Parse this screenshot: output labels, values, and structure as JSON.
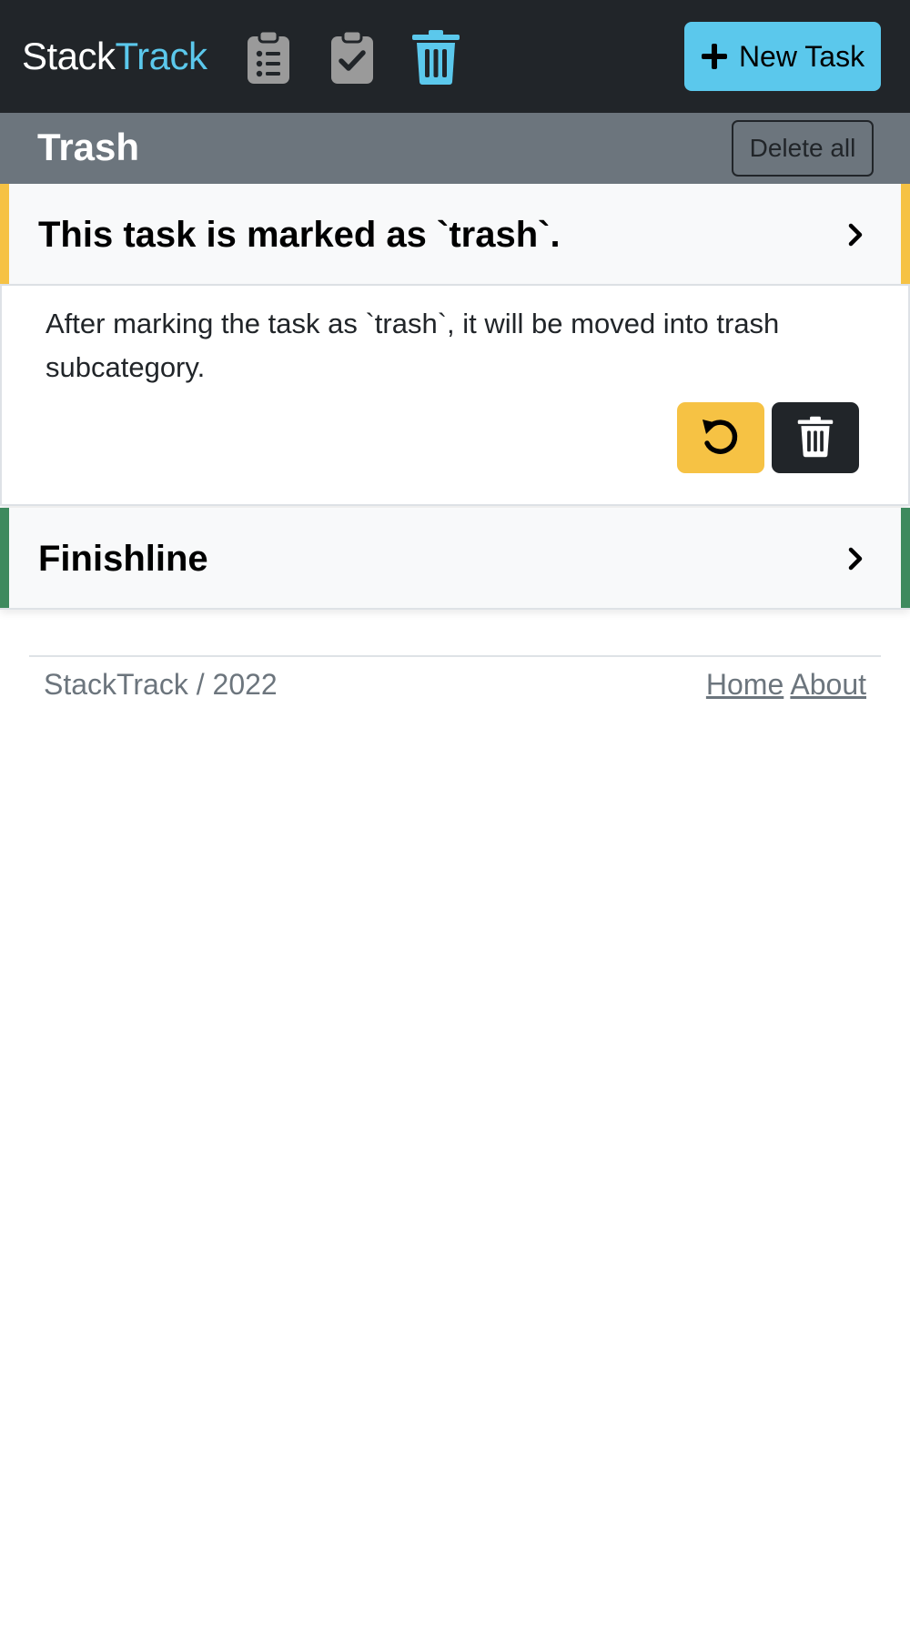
{
  "navbar": {
    "brand_part1": "Stack",
    "brand_part2": "Track",
    "icons": [
      "clipboard-list-icon",
      "clipboard-check-icon",
      "trash-icon"
    ],
    "active_icon": "trash-icon",
    "new_task_label": "New Task",
    "new_task_icon": "plus-icon",
    "colors": {
      "background": "#212529",
      "accent": "#5bc8ec",
      "inactive_icon": "#9a9a9a"
    }
  },
  "section": {
    "title": "Trash",
    "delete_all_label": "Delete all",
    "background": "#6c757d"
  },
  "tasks": [
    {
      "title": "This task is marked as `trash`.",
      "description": "After marking the task as `trash`, it will be moved into trash subcategory.",
      "expanded": true,
      "accent_color": "#f6c244",
      "actions": [
        "restore-icon",
        "trash-icon"
      ]
    },
    {
      "title": "Finishline",
      "expanded": false,
      "accent_color": "#3e8a5e"
    }
  ],
  "footer": {
    "copyright": "StackTrack / 2022",
    "links": [
      "Home",
      "About"
    ]
  }
}
